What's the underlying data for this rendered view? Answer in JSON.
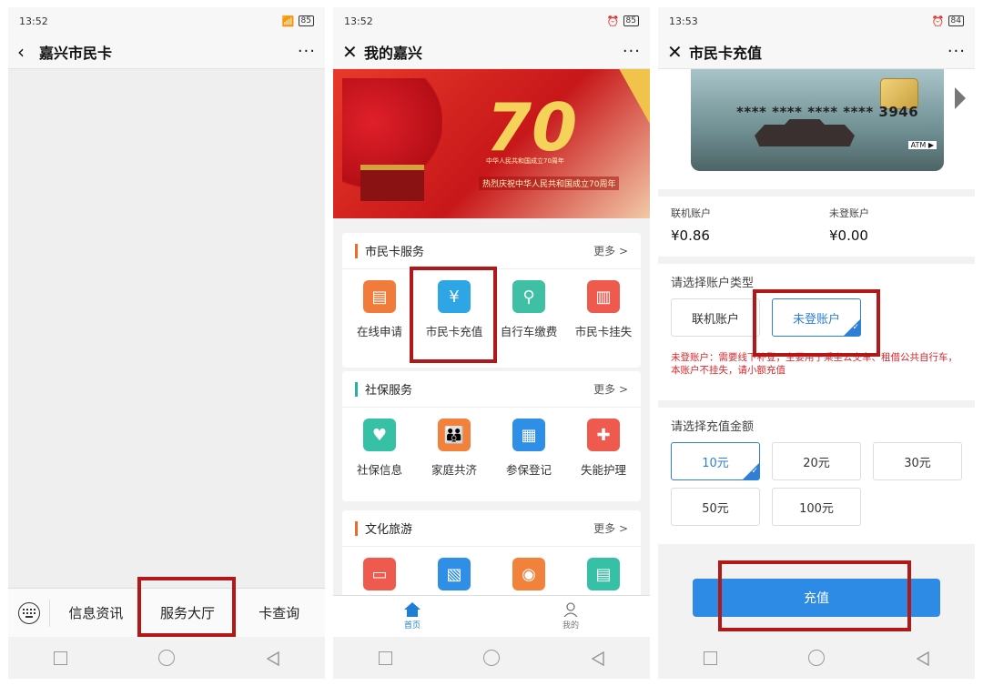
{
  "phone1": {
    "status_time": "13:52",
    "battery": "85",
    "title": "嘉兴市民卡",
    "menu": [
      {
        "label": "信息资讯"
      },
      {
        "label": "服务大厅"
      },
      {
        "label": "卡查询"
      }
    ]
  },
  "phone2": {
    "status_time": "13:52",
    "battery": "85",
    "title": "我的嘉兴",
    "banner": {
      "number": "70",
      "subtitle": "中华人民共和国成立70周年",
      "slogan": "热烈庆祝中华人民共和国成立70周年"
    },
    "sections": [
      {
        "title": "市民卡服务",
        "more": "更多 >",
        "accent": "#ee6a2c",
        "items": [
          {
            "label": "在线申请",
            "icon": "id-card-icon",
            "color": "#f07b3a"
          },
          {
            "label": "市民卡充值",
            "icon": "recharge-icon",
            "color": "#2ea6e6"
          },
          {
            "label": "自行车缴费",
            "icon": "bicycle-icon",
            "color": "#3fc0a4"
          },
          {
            "label": "市民卡挂失",
            "icon": "card-lost-icon",
            "color": "#ef5a4e"
          }
        ]
      },
      {
        "title": "社保服务",
        "more": "更多 >",
        "accent": "#28b1a2",
        "items": [
          {
            "label": "社保信息",
            "icon": "heart-hand-icon",
            "color": "#36c1a6"
          },
          {
            "label": "家庭共济",
            "icon": "family-icon",
            "color": "#f2813b"
          },
          {
            "label": "参保登记",
            "icon": "clipboard-icon",
            "color": "#2f8ee5"
          },
          {
            "label": "失能护理",
            "icon": "nurse-icon",
            "color": "#ef5a4e"
          }
        ]
      },
      {
        "title": "文化旅游",
        "more": "更多 >",
        "accent": "#ee6a2c",
        "items": [
          {
            "label": "",
            "icon": "ticket-icon",
            "color": "#ef5a4e"
          },
          {
            "label": "",
            "icon": "map-icon",
            "color": "#2f8ee5"
          },
          {
            "label": "",
            "icon": "location-icon",
            "color": "#f2813b"
          },
          {
            "label": "",
            "icon": "book-icon",
            "color": "#36c1a6"
          }
        ]
      }
    ],
    "tabs": [
      {
        "label": "首页",
        "icon": "home-icon"
      },
      {
        "label": "我的",
        "icon": "person-icon"
      }
    ]
  },
  "phone3": {
    "status_time": "13:53",
    "battery": "84",
    "title": "市民卡充值",
    "card": {
      "number": "**** **** **** **** 3946",
      "atm": "ATM ▶"
    },
    "accounts": [
      {
        "label": "联机账户",
        "value": "¥0.86"
      },
      {
        "label": "未登账户",
        "value": "¥0.00"
      }
    ],
    "account_type": {
      "title": "请选择账户类型",
      "options": [
        "联机账户",
        "未登账户"
      ],
      "selected": 1
    },
    "warning": "未登账户：需要线下补登，主要用于乘坐公交车、租借公共自行车，本账户不挂失，请小额充值",
    "amount": {
      "title": "请选择充值金额",
      "options": [
        "10元",
        "20元",
        "30元",
        "50元",
        "100元"
      ],
      "selected": 0
    },
    "pay_label": "充值"
  },
  "colors": {
    "highlight": "#b31818",
    "accent_blue": "#2d8be6",
    "warning_red": "#e0242a"
  }
}
